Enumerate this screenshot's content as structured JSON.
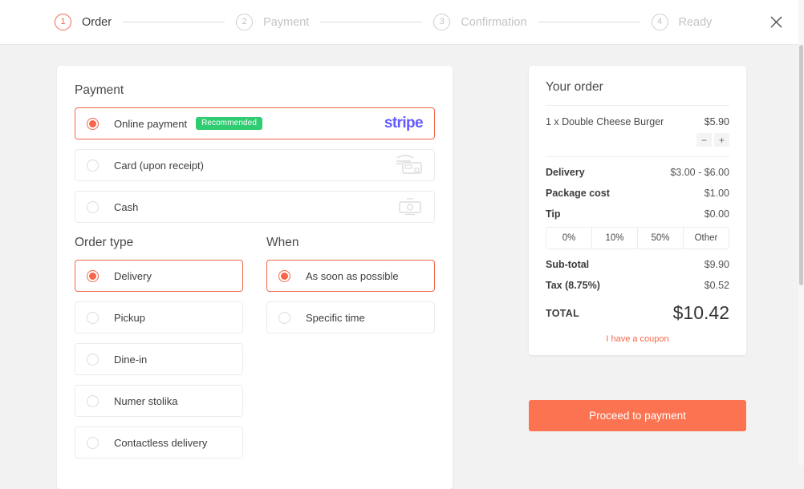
{
  "stepper": {
    "steps": [
      {
        "num": "1",
        "label": "Order",
        "state": "active"
      },
      {
        "num": "2",
        "label": "Payment",
        "state": "inactive"
      },
      {
        "num": "3",
        "label": "Confirmation",
        "state": "inactive"
      },
      {
        "num": "4",
        "label": "Ready",
        "state": "inactive"
      }
    ],
    "close_icon": "close-icon"
  },
  "payment": {
    "title": "Payment",
    "options": [
      {
        "label": "Online payment",
        "selected": true,
        "badge": "Recommended",
        "logo": "stripe",
        "icon": ""
      },
      {
        "label": "Card (upon receipt)",
        "selected": false,
        "badge": "",
        "logo": "",
        "icon": "card-terminal-icon"
      },
      {
        "label": "Cash",
        "selected": false,
        "badge": "",
        "logo": "",
        "icon": "banknote-icon"
      }
    ]
  },
  "order_type": {
    "title": "Order type",
    "options": [
      {
        "label": "Delivery",
        "selected": true
      },
      {
        "label": "Pickup",
        "selected": false
      },
      {
        "label": "Dine-in",
        "selected": false
      },
      {
        "label": "Numer stolika",
        "selected": false
      },
      {
        "label": "Contactless delivery",
        "selected": false
      }
    ]
  },
  "when": {
    "title": "When",
    "options": [
      {
        "label": "As soon as possible",
        "selected": true
      },
      {
        "label": "Specific time",
        "selected": false
      }
    ]
  },
  "summary": {
    "title": "Your order",
    "item": {
      "name": "1 x Double Cheese Burger",
      "price": "$5.90",
      "decrease": "−",
      "increase": "+"
    },
    "fees": [
      {
        "label": "Delivery",
        "value": "$3.00 - $6.00"
      },
      {
        "label": "Package cost",
        "value": "$1.00"
      }
    ],
    "tip": {
      "label": "Tip",
      "value": "$0.00",
      "options": [
        "0%",
        "10%",
        "50%",
        "Other"
      ]
    },
    "totals": [
      {
        "label": "Sub-total",
        "value": "$9.90"
      },
      {
        "label": "Tax (8.75%)",
        "value": "$0.52"
      }
    ],
    "total": {
      "label": "TOTAL",
      "value": "$10.42"
    },
    "coupon": "I have a coupon",
    "cta": "Proceed to payment"
  },
  "colors": {
    "accent": "#f4674a",
    "cta": "#fb7350",
    "badge_green": "#2fcc71",
    "stripe_purple": "#635bff",
    "page_bg": "#f2f2f2"
  }
}
